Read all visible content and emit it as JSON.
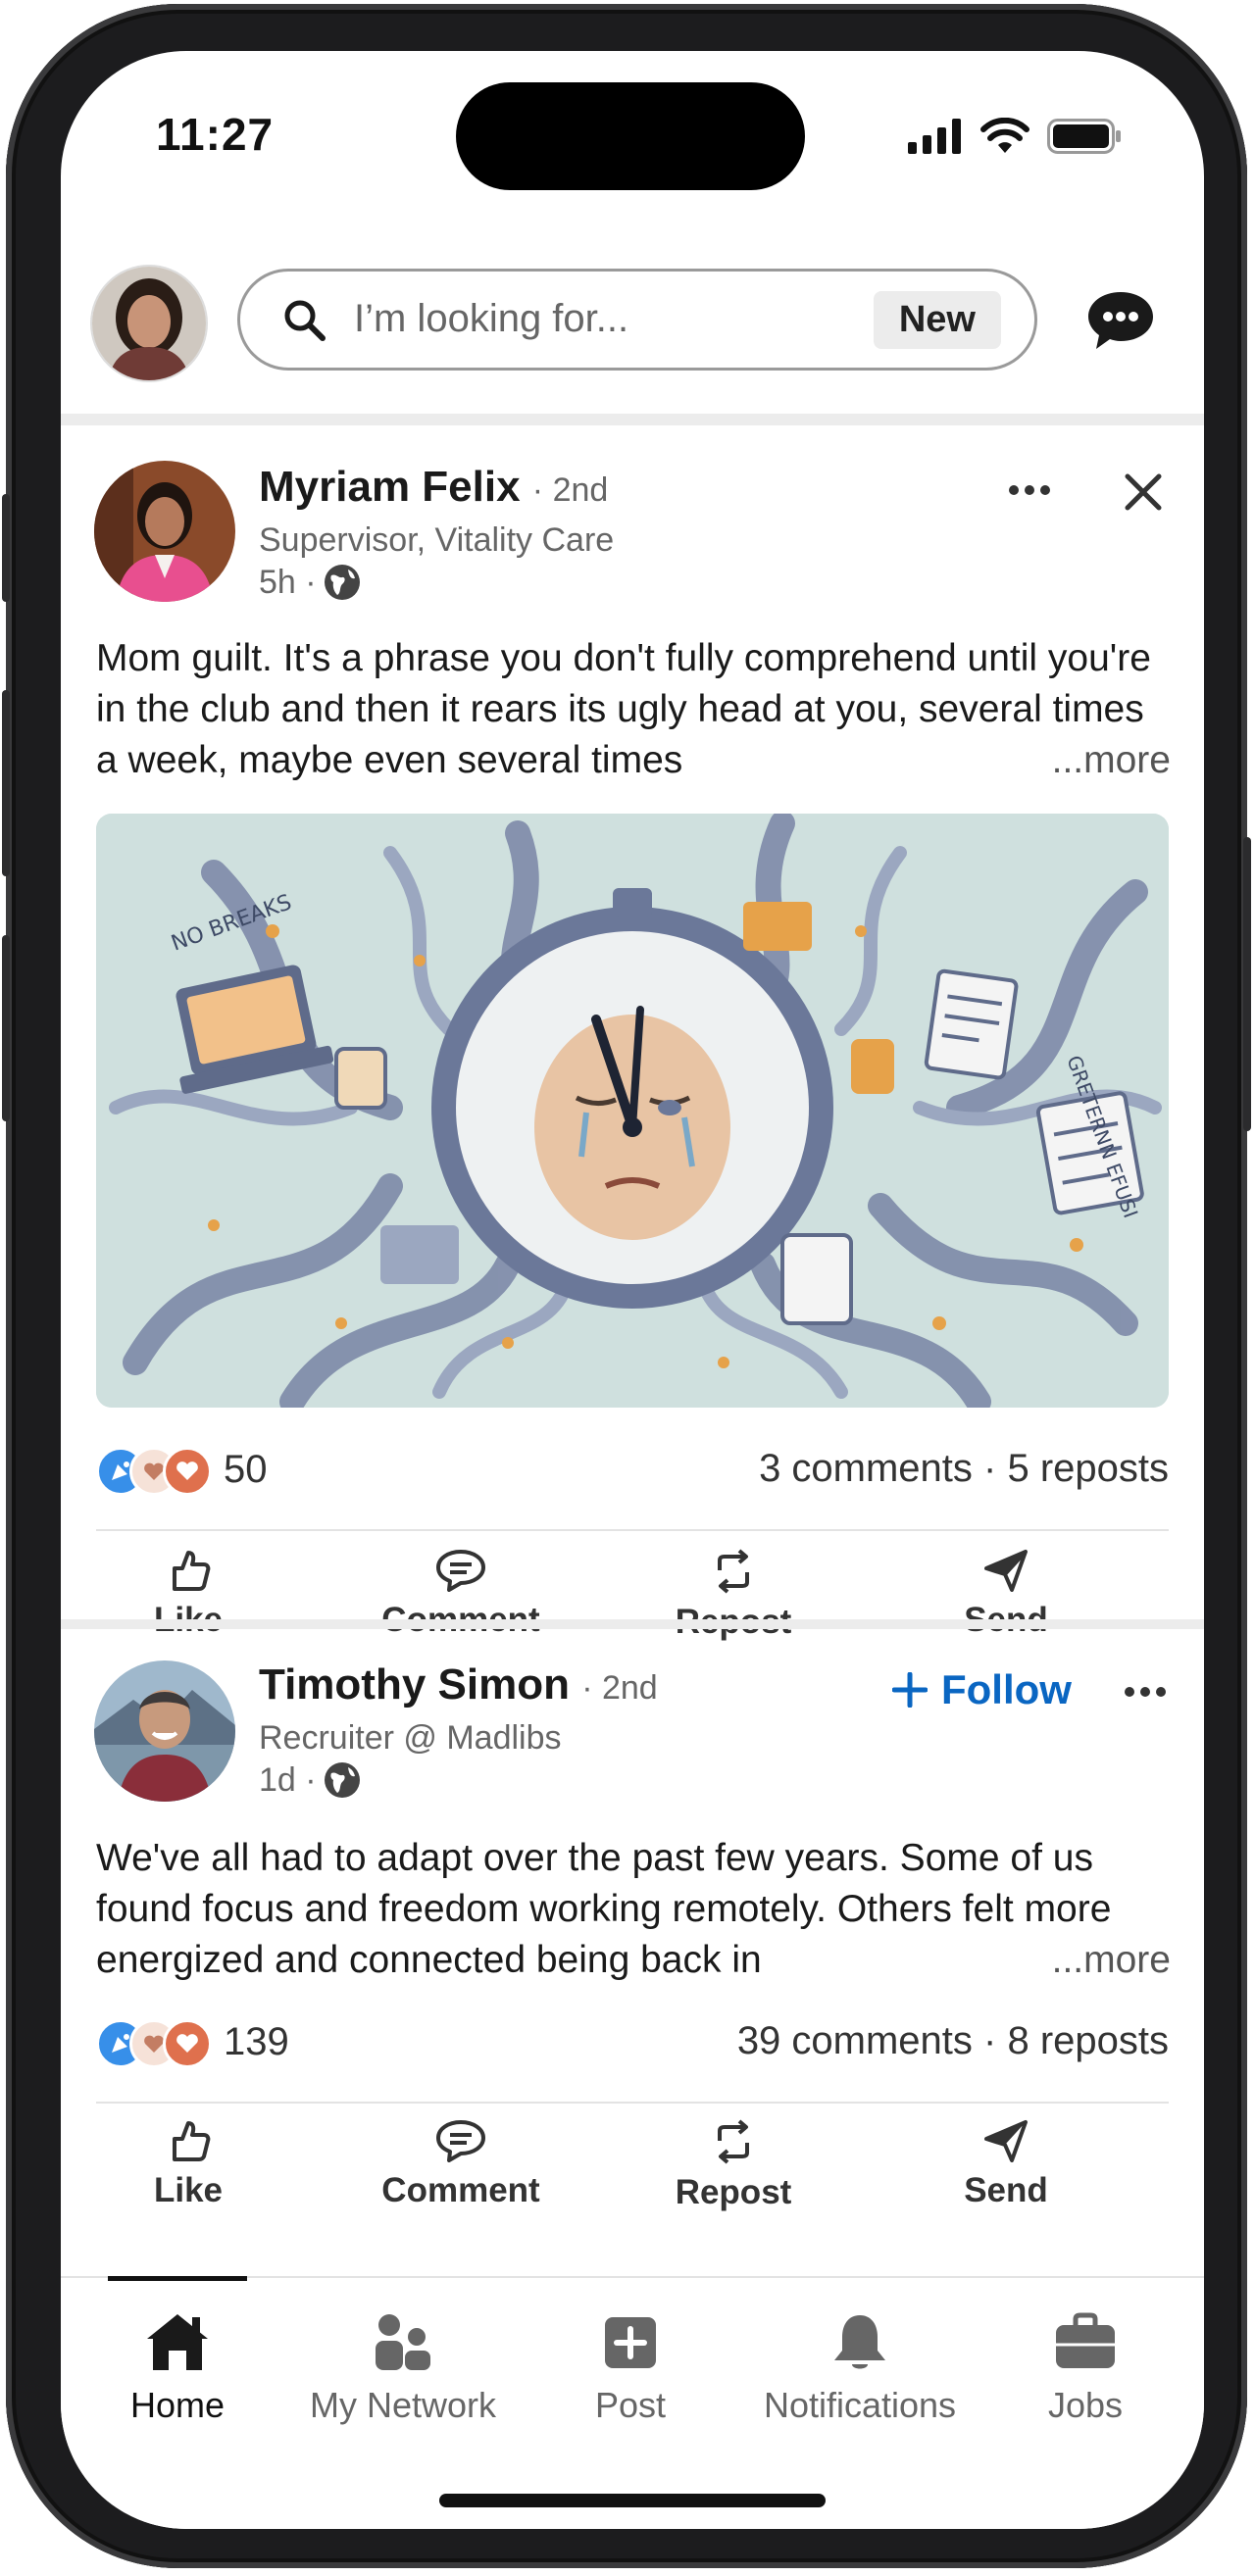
{
  "status": {
    "time": "11:27"
  },
  "search": {
    "placeholder": "I’m looking for...",
    "badge": "New"
  },
  "posts": [
    {
      "author": "Myriam Felix",
      "degree": "· 2nd",
      "title": "Supervisor, Vitality Care",
      "time": "5h ·",
      "text": "Mom guilt. It's a phrase you don't fully comprehend until you're in the club and then it rears its ugly head at you, several times a week, maybe even several times",
      "more": "...more",
      "image_labels": {
        "left": "NO BREAKS",
        "right": "GRETERNN EFUSI"
      },
      "reaction_count": "50",
      "counts": "3 comments · 5 reposts"
    },
    {
      "author": "Timothy Simon",
      "degree": "· 2nd",
      "title": "Recruiter @ Madlibs",
      "time": "1d ·",
      "follow": "Follow",
      "text": "We've all had to adapt over the past few years. Some of us found focus and freedom working remotely. Others felt more energized and connected being back in",
      "more": "...more",
      "reaction_count": "139",
      "counts": "39 comments · 8 reposts"
    }
  ],
  "actions": {
    "like": "Like",
    "comment": "Comment",
    "repost": "Repost",
    "send": "Send"
  },
  "nav": [
    {
      "label": "Home",
      "icon": "home-icon",
      "active": true
    },
    {
      "label": "My Network",
      "icon": "network-icon"
    },
    {
      "label": "Post",
      "icon": "post-icon"
    },
    {
      "label": "Notifications",
      "icon": "bell-icon"
    },
    {
      "label": "Jobs",
      "icon": "briefcase-icon"
    }
  ],
  "colors": {
    "accent": "#0a66c2",
    "text": "#1a1a1a",
    "muted": "#666666"
  }
}
